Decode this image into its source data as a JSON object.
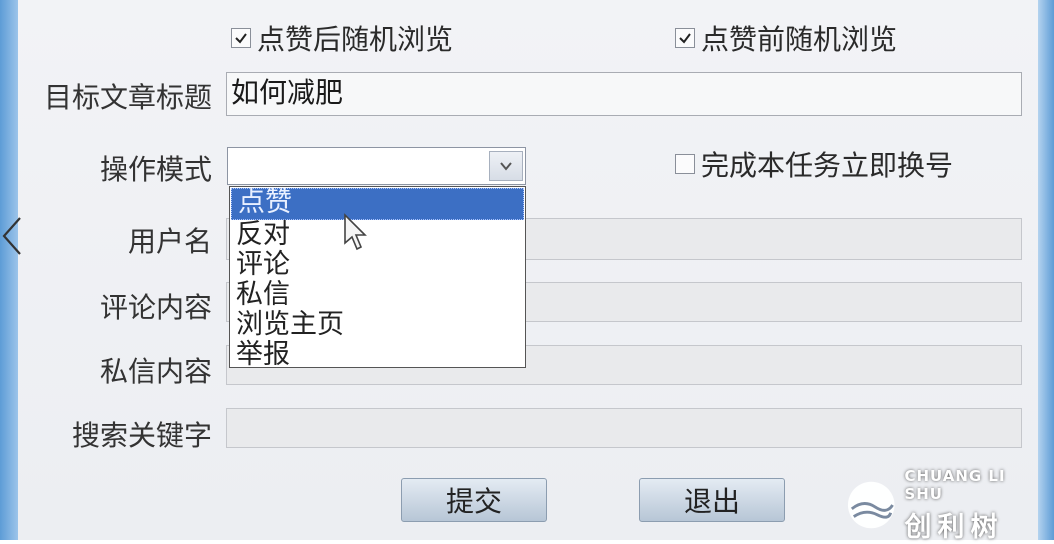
{
  "options": {
    "random_after_like": "点赞后随机浏览",
    "random_before_like": "点赞前随机浏览",
    "switch_account": "完成本任务立即换号"
  },
  "form": {
    "title_label": "目标文章标题",
    "title_value": "如何减肥",
    "mode_label": "操作模式",
    "username_label": "用户名",
    "comment_label": "评论内容",
    "message_label": "私信内容",
    "keyword_label": "搜索关键字"
  },
  "dropdown": {
    "items": [
      "点赞",
      "反对",
      "评论",
      "私信",
      "浏览主页",
      "举报"
    ]
  },
  "buttons": {
    "submit": "提交",
    "exit": "退出"
  },
  "logo": {
    "en": "CHUANG LI SHU",
    "cn": "创利树"
  },
  "colors": {
    "selection": "#3c6fc4",
    "frame": "#5d9cd6"
  }
}
